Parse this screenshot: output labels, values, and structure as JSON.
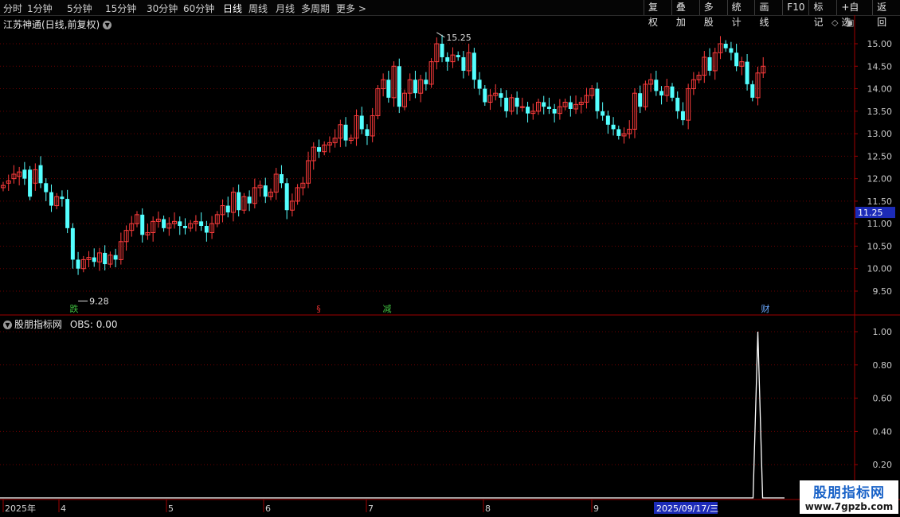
{
  "toolbar": {
    "periods": [
      "分时",
      "1分钟",
      "5分钟",
      "15分钟",
      "30分钟",
      "60分钟",
      "日线",
      "周线",
      "月线",
      "多周期",
      "更多 >"
    ],
    "active_period": "日线",
    "right_buttons": [
      "复权",
      "叠加",
      "多股",
      "统计",
      "画线",
      "F10",
      "标记",
      "+自选",
      "返回"
    ]
  },
  "main_chart": {
    "title": "江苏神通(日线,前复权)",
    "high_marker": "15.25",
    "low_marker": "9.28",
    "current_price_tag": "11.25",
    "price_axis": [
      "15.00",
      "14.50",
      "14.00",
      "13.50",
      "13.00",
      "12.50",
      "12.00",
      "11.50",
      "11.00",
      "10.50",
      "10.00",
      "9.50"
    ],
    "event_marks": [
      {
        "text": "跌",
        "color": "#3fbf3f"
      },
      {
        "text": "§",
        "color": "#e03030"
      },
      {
        "text": "减",
        "color": "#3fbf3f"
      },
      {
        "text": "财",
        "color": "#6aa8ff"
      }
    ]
  },
  "indicator": {
    "title": "股朋指标网",
    "value_text": "OBS: 0.00",
    "axis": [
      "1.00",
      "0.80",
      "0.60",
      "0.40",
      "0.20"
    ]
  },
  "date_axis": [
    "2025年",
    "4",
    "5",
    "6",
    "7",
    "8",
    "9",
    "2025/09/17/三"
  ],
  "watermark": {
    "line1": "股朋指标网",
    "line2": "www.7gpzb.com"
  },
  "colors": {
    "up": "#ff3c3c",
    "down": "#54ffff",
    "grid": "#6a0000",
    "axis": "#a00000",
    "indicator_line": "#ffffff"
  },
  "chart_data": [
    {
      "type": "candlestick",
      "title": "江苏神通(日线,前复权)",
      "ylim": [
        9.0,
        15.4
      ],
      "y_ticks": [
        9.5,
        10.0,
        10.5,
        11.0,
        11.5,
        12.0,
        12.5,
        13.0,
        13.5,
        14.0,
        14.5,
        15.0
      ],
      "series": [
        {
          "close": [
            11.85,
            11.95,
            12.1,
            12.15,
            12.0,
            11.6,
            12.2,
            11.9,
            11.7,
            11.4,
            11.6,
            11.55,
            10.9,
            10.2,
            10.0,
            10.2,
            10.25,
            10.15,
            10.35,
            10.1,
            10.3,
            10.2,
            10.6,
            10.85,
            11.0,
            11.2,
            10.75,
            10.8,
            11.05,
            11.1,
            10.9,
            11.0,
            11.05,
            10.95,
            10.9,
            11.0,
            11.05,
            10.95,
            10.8,
            11.0,
            11.2,
            11.4,
            11.25,
            11.7,
            11.3,
            11.6,
            11.45,
            11.8,
            11.85,
            11.6,
            11.7,
            12.1,
            11.9,
            11.3,
            11.5,
            11.8,
            11.9,
            12.4,
            12.7,
            12.6,
            12.75,
            12.8,
            12.9,
            13.2,
            12.85,
            12.9,
            13.4,
            13.1,
            12.95,
            13.4,
            14.0,
            14.2,
            13.8,
            14.5,
            13.6,
            13.9,
            14.2,
            13.9,
            14.2,
            14.1,
            14.6,
            15.0,
            14.7,
            14.6,
            14.75,
            14.7,
            14.4,
            14.8,
            14.2,
            14.0,
            13.7,
            13.85,
            13.9,
            13.8,
            13.5,
            13.8,
            13.6,
            13.6,
            13.45,
            13.5,
            13.7,
            13.6,
            13.55,
            13.45,
            13.6,
            13.7,
            13.55,
            13.65,
            13.7,
            13.85,
            14.0,
            13.5,
            13.4,
            13.2,
            13.1,
            12.95,
            13.0,
            13.1,
            13.9,
            13.6,
            14.1,
            14.2,
            13.95,
            13.85,
            14.05,
            13.8,
            13.5,
            13.3,
            14.0,
            14.2,
            14.3,
            14.7,
            14.4,
            14.8,
            15.0,
            14.9,
            14.8,
            14.5,
            14.6,
            14.1,
            13.8,
            14.35,
            14.5
          ],
          "open": [
            11.8,
            11.9,
            12.0,
            12.05,
            12.2,
            12.2,
            11.9,
            12.3,
            11.9,
            11.7,
            11.4,
            11.6,
            11.55,
            10.9,
            10.2,
            10.0,
            10.2,
            10.25,
            10.15,
            10.35,
            10.1,
            10.3,
            10.2,
            10.6,
            10.85,
            11.0,
            11.2,
            10.75,
            10.8,
            11.05,
            11.1,
            10.9,
            11.0,
            11.05,
            10.95,
            10.9,
            11.0,
            11.05,
            10.95,
            10.8,
            11.0,
            11.2,
            11.4,
            11.25,
            11.7,
            11.3,
            11.6,
            11.45,
            11.8,
            11.85,
            11.6,
            11.7,
            12.1,
            11.9,
            11.3,
            11.5,
            11.8,
            11.9,
            12.4,
            12.7,
            12.6,
            12.75,
            12.8,
            12.9,
            13.2,
            12.85,
            12.9,
            13.4,
            13.1,
            12.95,
            13.4,
            14.0,
            14.2,
            13.8,
            14.5,
            13.6,
            13.9,
            14.2,
            13.9,
            14.2,
            14.1,
            14.6,
            15.0,
            14.7,
            14.6,
            14.75,
            14.7,
            14.4,
            14.8,
            14.2,
            14.0,
            13.7,
            13.85,
            13.9,
            13.8,
            13.5,
            13.8,
            13.6,
            13.6,
            13.45,
            13.5,
            13.7,
            13.6,
            13.55,
            13.45,
            13.6,
            13.7,
            13.55,
            13.65,
            13.7,
            13.85,
            14.0,
            13.5,
            13.4,
            13.2,
            13.1,
            12.95,
            13.0,
            13.1,
            13.9,
            13.6,
            14.1,
            14.2,
            13.95,
            13.85,
            14.05,
            13.8,
            13.5,
            13.3,
            14.0,
            14.2,
            14.3,
            14.7,
            14.4,
            14.8,
            15.0,
            14.9,
            14.8,
            14.5,
            14.6,
            14.1,
            13.8,
            14.35
          ]
        }
      ]
    },
    {
      "type": "line",
      "title": "股朋指标网",
      "ylim": [
        0,
        1.1
      ],
      "y_ticks": [
        0.2,
        0.4,
        0.6,
        0.8,
        1.0
      ],
      "series": [
        {
          "name": "OBS",
          "spike_index": 141,
          "spike_value": 1.0
        }
      ]
    }
  ]
}
